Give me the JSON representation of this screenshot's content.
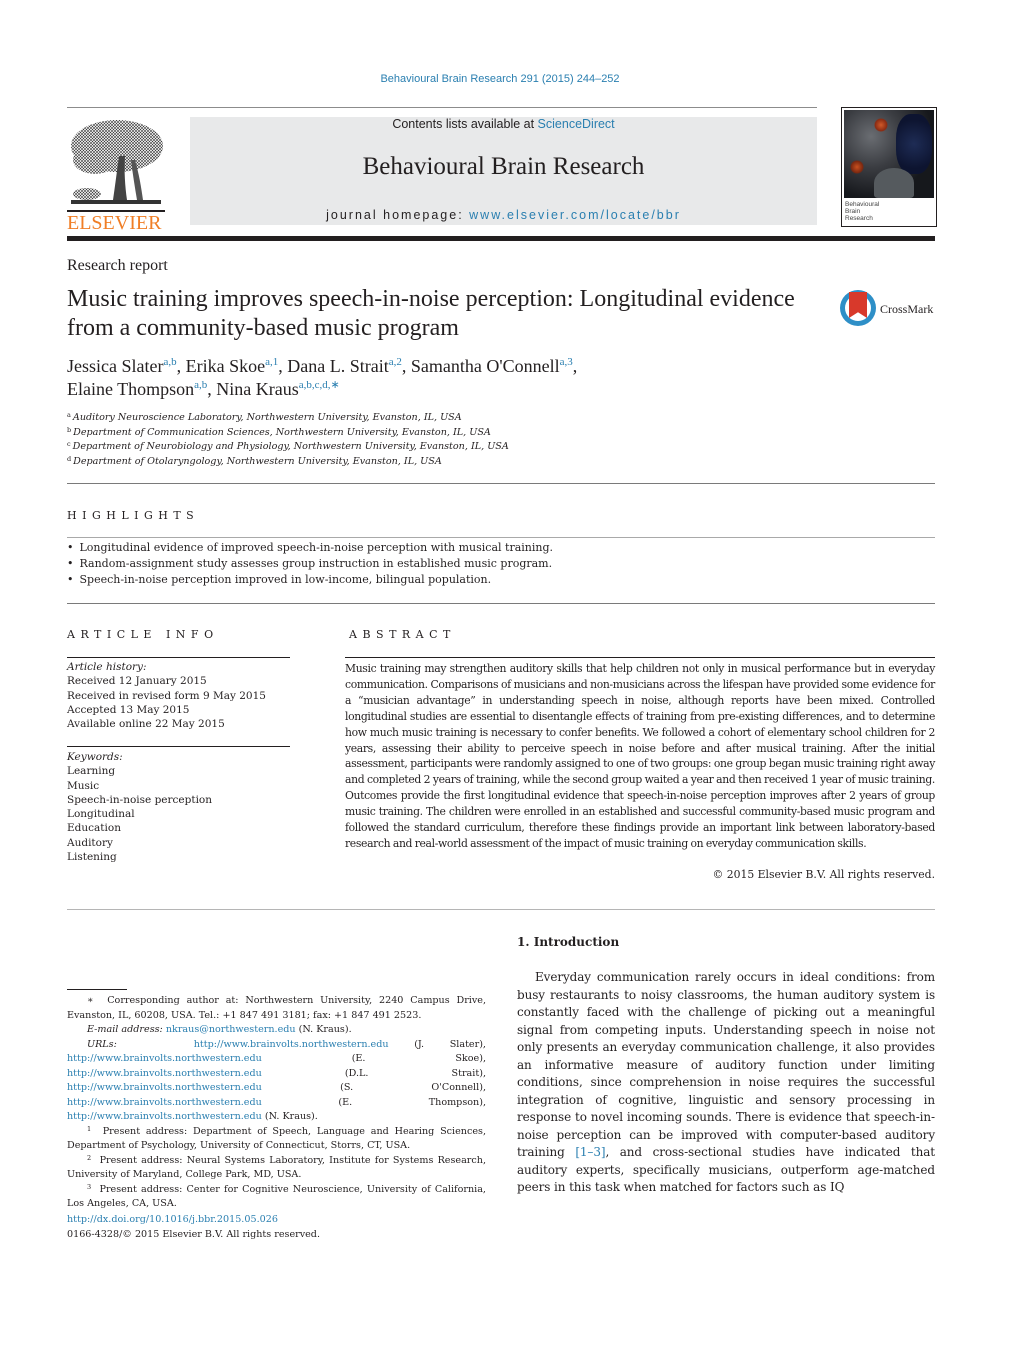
{
  "header": {
    "citation": "Behavioural Brain Research 291 (2015) 244–252",
    "contents_prefix": "Contents lists available at ",
    "contents_link": "ScienceDirect",
    "journal_title": "Behavioural Brain Research",
    "homepage_prefix": "journal homepage: ",
    "homepage_link": "www.elsevier.com/locate/bbr",
    "publisher": "ELSEVIER",
    "cover_label_1": "Behavioural",
    "cover_label_2": "Brain",
    "cover_label_3": "Research",
    "crossmark": "CrossMark"
  },
  "article": {
    "type": "Research report",
    "title": "Music training improves speech-in-noise perception: Longitudinal evidence from a community-based music program",
    "authors": [
      {
        "name": "Jessica Slater",
        "sup": "a,b",
        "sep": ", "
      },
      {
        "name": "Erika Skoe",
        "sup": "a,1",
        "sep": ", "
      },
      {
        "name": "Dana L. Strait",
        "sup": "a,2",
        "sep": ", "
      },
      {
        "name": "Samantha O'Connell",
        "sup": "a,3",
        "sep": ","
      },
      {
        "name": "Elaine Thompson",
        "sup": "a,b",
        "sep": ", "
      },
      {
        "name": "Nina Kraus",
        "sup": "a,b,c,d,∗",
        "sep": ""
      }
    ],
    "affiliations": [
      {
        "key": "a",
        "text": "Auditory Neuroscience Laboratory, Northwestern University, Evanston, IL, USA"
      },
      {
        "key": "b",
        "text": "Department of Communication Sciences, Northwestern University, Evanston, IL, USA"
      },
      {
        "key": "c",
        "text": "Department of Neurobiology and Physiology, Northwestern University, Evanston, IL, USA"
      },
      {
        "key": "d",
        "text": "Department of Otolaryngology, Northwestern University, Evanston, IL, USA"
      }
    ]
  },
  "highlights": {
    "heading": "HIGHLIGHTS",
    "items": [
      "Longitudinal evidence of improved speech-in-noise perception with musical training.",
      "Random-assignment study assesses group instruction in established music program.",
      "Speech-in-noise perception improved in low-income, bilingual population."
    ]
  },
  "article_info": {
    "heading": "ARTICLE INFO",
    "history_label": "Article history:",
    "history": [
      "Received 12 January 2015",
      "Received in revised form 9 May 2015",
      "Accepted 13 May 2015",
      "Available online 22 May 2015"
    ],
    "keywords_label": "Keywords:",
    "keywords": [
      "Learning",
      "Music",
      "Speech-in-noise perception",
      "Longitudinal",
      "Education",
      "Auditory",
      "Listening"
    ]
  },
  "abstract": {
    "heading": "ABSTRACT",
    "text": "Music training may strengthen auditory skills that help children not only in musical performance but in everyday communication. Comparisons of musicians and non-musicians across the lifespan have provided some evidence for a “musician advantage” in understanding speech in noise, although reports have been mixed. Controlled longitudinal studies are essential to disentangle effects of training from pre-existing differences, and to determine how much music training is necessary to confer benefits. We followed a cohort of elementary school children for 2 years, assessing their ability to perceive speech in noise before and after musical training. After the initial assessment, participants were randomly assigned to one of two groups: one group began music training right away and completed 2 years of training, while the second group waited a year and then received 1 year of music training. Outcomes provide the first longitudinal evidence that speech-in-noise perception improves after 2 years of group music training. The children were enrolled in an established and successful community-based music program and followed the standard curriculum, therefore these findings provide an important link between laboratory-based research and real-world assessment of the impact of music training on everyday communication skills.",
    "copyright": "© 2015 Elsevier B.V. All rights reserved."
  },
  "introduction": {
    "heading": "1.  Introduction",
    "text_before_ref": "Everyday communication rarely occurs in ideal conditions: from busy restaurants to noisy classrooms, the human auditory system is constantly faced with the challenge of picking out a meaningful signal from competing inputs. Understanding speech in noise not only presents an everyday communication challenge, it also provides an informative measure of auditory function under limiting conditions, since comprehension in noise requires the successful integration of cognitive, linguistic and sensory processing in response to novel incoming sounds. There is evidence that speech-in-noise perception can be improved with computer-based auditory training ",
    "ref": "[1–3]",
    "text_after_ref": ", and cross-sectional studies have indicated that auditory experts, specifically musicians, outperform age-matched peers in this task when matched for factors such as IQ"
  },
  "footnotes": {
    "corresponding_mark": "∗",
    "corresponding": "Corresponding author at: Northwestern University, 2240 Campus Drive, Evanston, IL, 60208, USA. Tel.: +1 847 491 3181; fax: +1 847 491 2523.",
    "email_label": "E-mail address:",
    "email": "nkraus@northwestern.edu",
    "email_owner": "(N. Kraus).",
    "urls_label": "URLs:",
    "urls": [
      {
        "url": "http://www.brainvolts.northwestern.edu",
        "owner": "(J. Slater), "
      },
      {
        "url": "http://www.brainvolts.northwestern.edu",
        "owner": "(E. Skoe), "
      },
      {
        "url": "http://www.brainvolts.northwestern.edu",
        "owner": "(D.L. Strait), "
      },
      {
        "url": "http://www.brainvolts.northwestern.edu",
        "owner": "(S. O'Connell), "
      },
      {
        "url": "http://www.brainvolts.northwestern.edu",
        "owner": "(E. Thompson), "
      },
      {
        "url": "http://www.brainvolts.northwestern.edu",
        "owner": "(N. Kraus)."
      }
    ],
    "present": [
      {
        "key": "1",
        "text": "Present address: Department of Speech, Language and Hearing Sciences, Department of Psychology, University of Connecticut, Storrs, CT, USA."
      },
      {
        "key": "2",
        "text": "Present address: Neural Systems Laboratory, Institute for Systems Research, University of Maryland, College Park, MD, USA."
      },
      {
        "key": "3",
        "text": "Present address: Center for Cognitive Neuroscience, University of California, Los Angeles, CA, USA."
      }
    ],
    "doi": "http://dx.doi.org/10.1016/j.bbr.2015.05.026",
    "issn_copyright": "0166-4328/© 2015 Elsevier B.V. All rights reserved."
  }
}
